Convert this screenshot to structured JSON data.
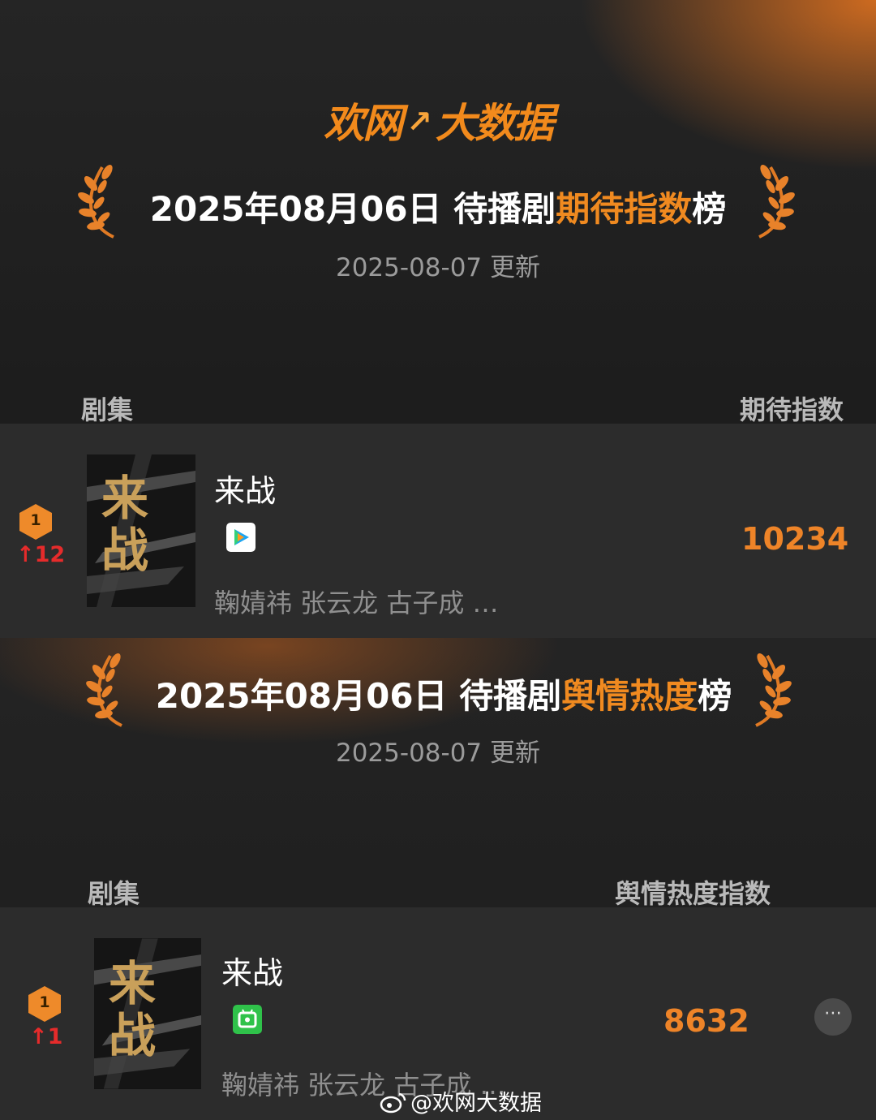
{
  "brand": {
    "name_left": "欢网",
    "name_right": "大数据"
  },
  "sections": [
    {
      "title_prefix": "2025年08月06日 待播剧",
      "title_highlight": "期待指数",
      "title_suffix": "榜",
      "updated": "2025-08-07 更新",
      "col_left": "剧集",
      "col_right": "期待指数",
      "entry": {
        "rank": "1",
        "rank_change": "↑12",
        "poster_text": "来战",
        "name": "来战",
        "platform_icon": "tencent-video-icon",
        "cast": "鞠婧祎 张云龙 古子成 …",
        "score": "10234"
      }
    },
    {
      "title_prefix": "2025年08月06日 待播剧",
      "title_highlight": "舆情热度",
      "title_suffix": "榜",
      "updated": "2025-08-07 更新",
      "col_left": "剧集",
      "col_right": "舆情热度指数",
      "entry": {
        "rank": "1",
        "rank_change": "↑1",
        "poster_text": "来战",
        "name": "来战",
        "platform_icon": "iqiyi-icon",
        "cast": "鞠婧祎 张云龙 古子成 …",
        "score": "8632"
      }
    }
  ],
  "more_button": "⋯",
  "watermark": "@欢网大数据",
  "colors": {
    "accent": "#f08a20",
    "rank_up": "#e62b2b",
    "row_bg": "#2c2c2c"
  }
}
